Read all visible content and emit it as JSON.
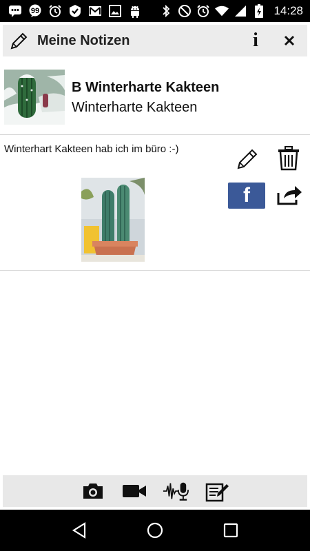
{
  "status_bar": {
    "time": "14:28",
    "left_icons": [
      "message-icon",
      "chat-icon",
      "alarm-icon",
      "check-icon",
      "gmail-icon",
      "image-icon",
      "android-icon"
    ],
    "right_icons": [
      "bluetooth-icon",
      "do-not-disturb-icon",
      "alarm-icon",
      "wifi-icon",
      "cell-signal-icon",
      "battery-charging-icon"
    ]
  },
  "app_bar": {
    "title": "Meine Notizen",
    "info_label": "i"
  },
  "entry": {
    "title": "B Winterharte Kakteen",
    "subtitle": "Winterharte Kakteen"
  },
  "note": {
    "text": "Winterhart Kakteen hab ich im büro :-)",
    "facebook_label": "f"
  },
  "toolbar": {
    "buttons": [
      "camera-icon",
      "video-camera-icon",
      "audio-record-icon",
      "edit-note-icon"
    ]
  },
  "nav": {
    "buttons": [
      "back-icon",
      "home-icon",
      "recents-icon"
    ]
  },
  "colors": {
    "facebook": "#3b5998",
    "app_bar_bg": "#ececec",
    "toolbar_bg": "#e8e8e8"
  }
}
